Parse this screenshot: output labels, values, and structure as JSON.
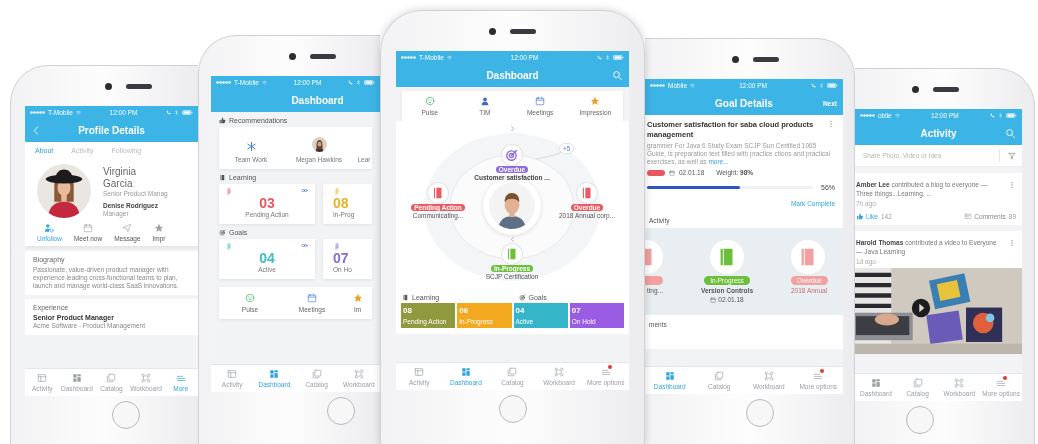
{
  "phones": [
    {
      "kind": "profile",
      "status": {
        "carrier": "T-Mobile",
        "time": "12:00 PM"
      },
      "title": "Profile Details",
      "tabs": [
        {
          "label": "About",
          "selected": true
        },
        {
          "label": "Activity",
          "selected": false
        },
        {
          "label": "Following",
          "selected": false
        }
      ],
      "person": {
        "first_name": "Virginia",
        "last_name": "Garcia",
        "role": "Senior Product Manag",
        "manager": "Denise Rodriguez",
        "manager_role": "Manager"
      },
      "actions": [
        {
          "kind": "unfollow",
          "label": "Unfollow",
          "selected": true
        },
        {
          "kind": "meet",
          "label": "Meet now",
          "selected": false
        },
        {
          "kind": "message",
          "label": "Message",
          "selected": false
        },
        {
          "kind": "impression",
          "label": "Impr",
          "selected": false
        }
      ],
      "biography": {
        "heading": "Biography",
        "text": "Passionate, value-driven product manager with experience leading cross-functional teams to plan, launch and manage world-class SaaS innovations."
      },
      "experience": {
        "heading": "Experience",
        "title": "Senior Product Manager",
        "text": "Acme Software - Product Management"
      },
      "nav": [
        {
          "kind": "activity",
          "label": "Activity",
          "selected": false,
          "alert": false
        },
        {
          "kind": "dashboard",
          "label": "Dashboard",
          "selected": false,
          "alert": false
        },
        {
          "kind": "catalog",
          "label": "Catalog",
          "selected": false,
          "alert": false
        },
        {
          "kind": "workboard",
          "label": "Workboard",
          "selected": false,
          "alert": false
        },
        {
          "kind": "more",
          "label": "More",
          "selected": true,
          "alert": false
        }
      ]
    },
    {
      "kind": "dashboard_cards",
      "status": {
        "carrier": "T-Mobile",
        "time": "12:00 PM"
      },
      "title": "Dashboard",
      "recommendations": {
        "heading": "Recommendations",
        "items": [
          {
            "kind": "topic",
            "label": "Team Work"
          },
          {
            "kind": "person",
            "label": "Megan Hawkins"
          },
          {
            "kind": "topic_cut",
            "label": "Lear"
          }
        ]
      },
      "learning": {
        "heading": "Learning",
        "cards": [
          {
            "count": "03",
            "label": "Pending Action",
            "color": "#e8585f"
          },
          {
            "count": "08",
            "label": "In-Prog",
            "color": "#e5b22a"
          }
        ]
      },
      "goals": {
        "heading": "Goals",
        "cards": [
          {
            "count": "04",
            "label": "Active",
            "color": "#3dbdbd"
          },
          {
            "count": "07",
            "label": "On Ho",
            "color": "#8a6bd0"
          }
        ]
      },
      "links": [
        {
          "kind": "pulse",
          "label": "Pulse"
        },
        {
          "kind": "meetings",
          "label": "Meetings"
        },
        {
          "kind": "impression",
          "label": "Im"
        }
      ],
      "nav": [
        {
          "kind": "activity",
          "label": "Activity",
          "selected": false,
          "alert": false
        },
        {
          "kind": "dashboard",
          "label": "Dashboard",
          "selected": true,
          "alert": false
        },
        {
          "kind": "catalog",
          "label": "Catalog",
          "selected": false,
          "alert": false
        },
        {
          "kind": "workboard",
          "label": "Workboard",
          "selected": false,
          "alert": false
        }
      ]
    },
    {
      "kind": "dashboard_orbit",
      "status": {
        "carrier": "T-Mobile",
        "time": "12:00 PM"
      },
      "title": "Dashboard",
      "links": [
        {
          "kind": "pulse",
          "label": "Pulse"
        },
        {
          "kind": "tim",
          "label": "TIM"
        },
        {
          "kind": "meetings",
          "label": "Meetings"
        },
        {
          "kind": "impression",
          "label": "Impression"
        }
      ],
      "orbit": {
        "more": "+5",
        "items": [
          {
            "status": "Overdue",
            "color": "#8e6be0",
            "label": "Customer satisfaction ..."
          },
          {
            "status": "Pending Action",
            "color": "#ea5a5f",
            "label": "Communicating..."
          },
          {
            "status": "Overdue",
            "color": "#ea5a5f",
            "label": "2018 Annual corp..."
          },
          {
            "status": "In-Progress",
            "color": "#6cbf3a",
            "label": "SCJP Certification"
          }
        ]
      },
      "learning": {
        "heading": "Learning",
        "tiles": [
          {
            "count": "08",
            "label": "Pending Action",
            "color": "#8f9a3e"
          },
          {
            "count": "06",
            "label": "In-Progress",
            "color": "#f2a91f"
          }
        ]
      },
      "goals": {
        "heading": "Goals",
        "tiles": [
          {
            "count": "04",
            "label": "Active",
            "color": "#35b6c8"
          },
          {
            "count": "07",
            "label": "On Hold",
            "color": "#9a5ce3"
          }
        ]
      },
      "nav": [
        {
          "kind": "activity",
          "label": "Activity",
          "selected": false,
          "alert": false
        },
        {
          "kind": "dashboard",
          "label": "Dashboard",
          "selected": true,
          "alert": false
        },
        {
          "kind": "catalog",
          "label": "Catalog",
          "selected": false,
          "alert": false
        },
        {
          "kind": "workboard",
          "label": "Workboard",
          "selected": false,
          "alert": false
        },
        {
          "kind": "more",
          "label": "More options",
          "selected": false,
          "alert": true
        }
      ]
    },
    {
      "kind": "goal_details",
      "status": {
        "carrier": "Mobile",
        "time": "12:00 PM"
      },
      "title": "Goal Details",
      "action": "Next",
      "goal": {
        "title": "Customer satisfaction for saba cloud products management",
        "description": "grammer For Java 6 Study Exam SCJP Sun Certified 1065 Guide, is preparation text filled with practice ctions and practical exercises, as well as",
        "more": "more...",
        "date": "02.01.18",
        "weight": "Weight: **98%**",
        "progress": {
          "level": 0.56,
          "reading": "56%"
        },
        "complete": "Mark Complete"
      },
      "activity": {
        "heading": "Activity",
        "nodes": [
          {
            "color": "#f2a0a0",
            "label": "ting..."
          },
          {
            "color": "#6cbf3a",
            "status": "In-Progress",
            "label": "Version Controls",
            "date": "02.01.18"
          },
          {
            "color": "#f2a0a0",
            "status": "Overdue",
            "label": "2018 Annual"
          }
        ]
      },
      "comments_heading": "ments",
      "nav": [
        {
          "kind": "dashboard",
          "label": "Dashboard",
          "selected": true,
          "alert": false
        },
        {
          "kind": "catalog",
          "label": "Catalog",
          "selected": false,
          "alert": false
        },
        {
          "kind": "workboard",
          "label": "Workboard",
          "selected": false,
          "alert": false
        },
        {
          "kind": "more",
          "label": "More options",
          "selected": false,
          "alert": true
        }
      ]
    },
    {
      "kind": "activity_feed",
      "status": {
        "carrier": "obile",
        "time": "12:00 PM"
      },
      "title": "Activity",
      "share": {
        "placeholder": "Share Photo, Video or Idea"
      },
      "posts": [
        {
          "text": "**Amber Lee** contributed a blog to everyone — Three things...Learning. ...",
          "time": "7h ago",
          "like": {
            "label": "Like",
            "count": "142"
          },
          "comments": {
            "label": "Comments",
            "count": "89"
          }
        },
        {
          "text": "**Harold Thomas** contributed a video to Everyone — Java Learning",
          "time": "1d ago"
        }
      ],
      "nav": [
        {
          "kind": "dashboard",
          "label": "Dashboard",
          "selected": false,
          "alert": false
        },
        {
          "kind": "catalog",
          "label": "Catalog",
          "selected": false,
          "alert": false
        },
        {
          "kind": "workboard",
          "label": "Workboard",
          "selected": false,
          "alert": false
        },
        {
          "kind": "more",
          "label": "More options",
          "selected": false,
          "alert": true
        }
      ]
    }
  ]
}
